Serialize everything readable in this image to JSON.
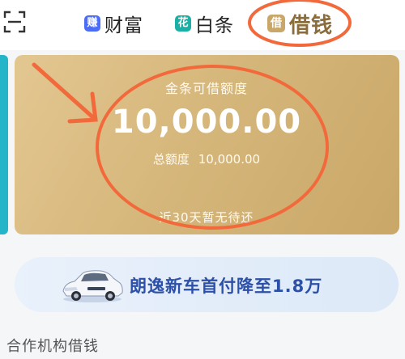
{
  "tabs": [
    {
      "badge": "赚",
      "label": "财富",
      "badge_color": "#4a6cf7",
      "active": false
    },
    {
      "badge": "花",
      "label": "白条",
      "badge_color": "#1bb0a5",
      "active": false
    },
    {
      "badge": "借",
      "label": "借钱",
      "badge_color": "#c9a768",
      "active": true
    }
  ],
  "scan_icon": "scan-icon",
  "card": {
    "title": "金条可借额度",
    "amount": "10,000.00",
    "total_label": "总额度",
    "total_value": "10,000.00",
    "due_text": "近30天暂无待还"
  },
  "banner": {
    "text": "朗逸新车首付降至1.8万",
    "icon": "car-image"
  },
  "section": {
    "heading": "合作机构借钱"
  },
  "colors": {
    "annotation": "#f26a3c",
    "card_gold": "#d6b77b",
    "banner_text": "#2c4fa8"
  }
}
